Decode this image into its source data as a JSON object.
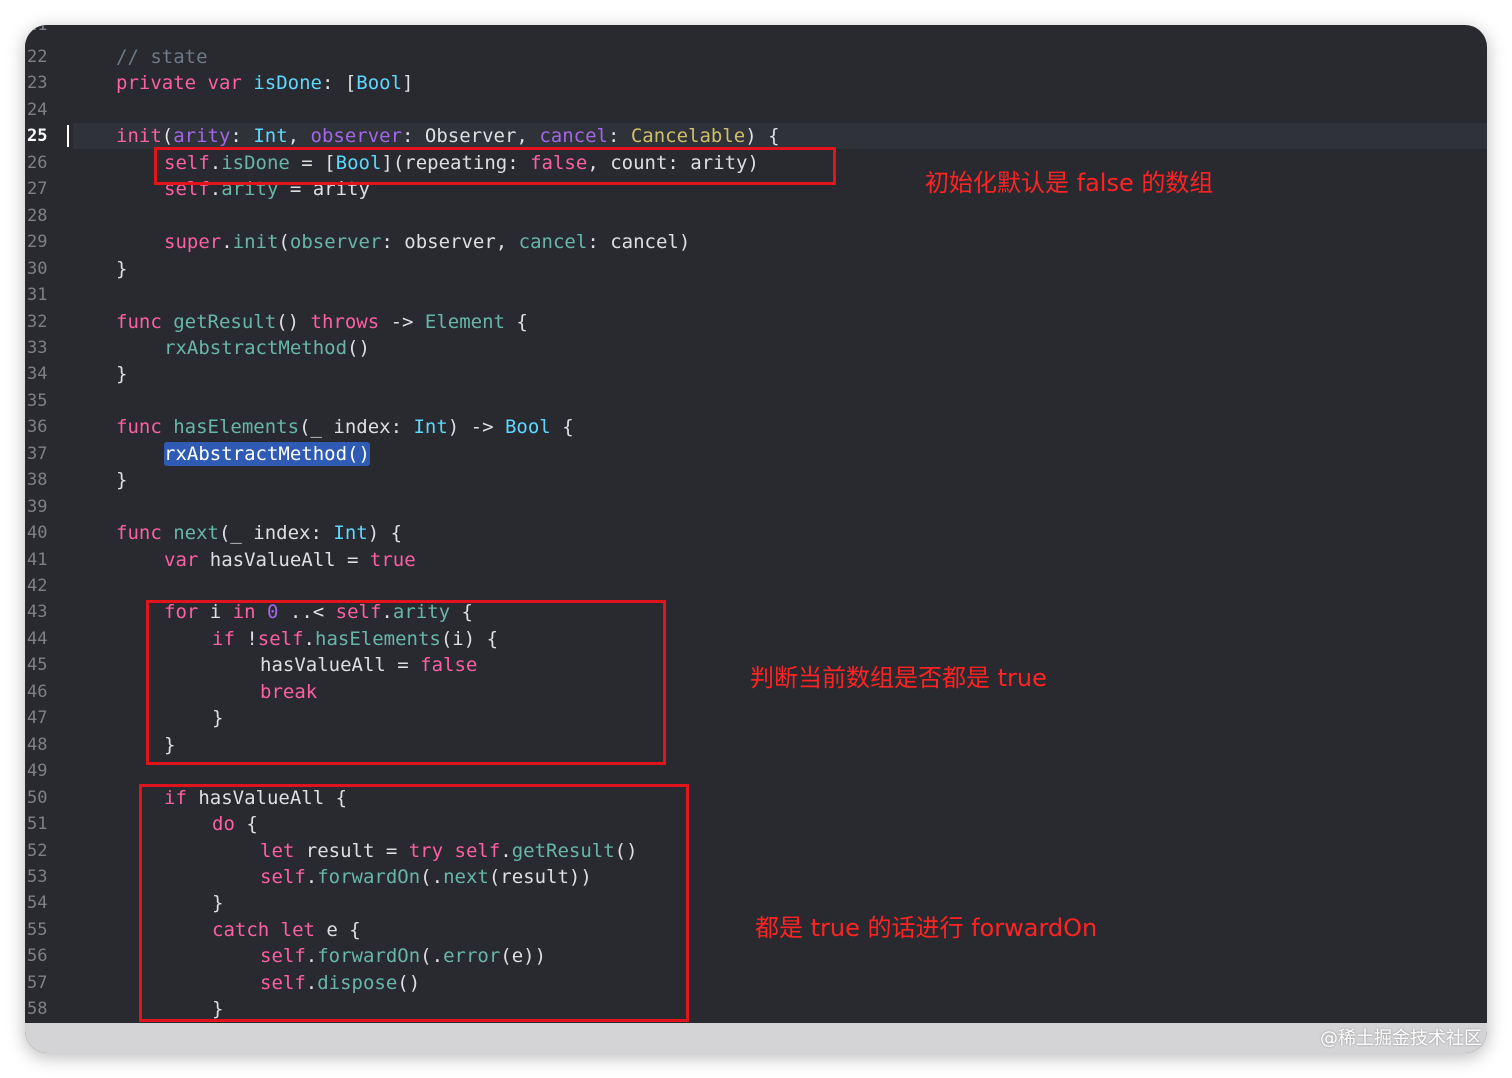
{
  "editor": {
    "partial_line_number": "21",
    "current_line": "25",
    "line_numbers": [
      "22",
      "23",
      "24",
      "25",
      "26",
      "27",
      "28",
      "29",
      "30",
      "31",
      "32",
      "33",
      "34",
      "35",
      "36",
      "37",
      "38",
      "39",
      "40",
      "41",
      "42",
      "43",
      "44",
      "45",
      "46",
      "47",
      "48",
      "49",
      "50",
      "51",
      "52",
      "53",
      "54",
      "55",
      "56",
      "57",
      "58"
    ],
    "code": [
      {
        "indent": 1,
        "tokens": [
          {
            "t": "// state",
            "c": "cm"
          }
        ]
      },
      {
        "indent": 1,
        "tokens": [
          {
            "t": "private",
            "c": "kw"
          },
          {
            "t": " "
          },
          {
            "t": "var",
            "c": "kw"
          },
          {
            "t": " "
          },
          {
            "t": "isDone",
            "c": "ty"
          },
          {
            "t": ": ["
          },
          {
            "t": "Bool",
            "c": "ty"
          },
          {
            "t": "]"
          }
        ]
      },
      {
        "indent": 0,
        "tokens": []
      },
      {
        "indent": 1,
        "tokens": [
          {
            "t": "init",
            "c": "kw"
          },
          {
            "t": "("
          },
          {
            "t": "arity",
            "c": "pr"
          },
          {
            "t": ": "
          },
          {
            "t": "Int",
            "c": "ty"
          },
          {
            "t": ", "
          },
          {
            "t": "observer",
            "c": "pr"
          },
          {
            "t": ": Observer, "
          },
          {
            "t": "cancel",
            "c": "pr"
          },
          {
            "t": ": "
          },
          {
            "t": "Cancelable",
            "c": "num"
          },
          {
            "t": ") {"
          }
        ]
      },
      {
        "indent": 2,
        "tokens": [
          {
            "t": "self",
            "c": "kw"
          },
          {
            "t": "."
          },
          {
            "t": "isDone",
            "c": "fn"
          },
          {
            "t": " = ["
          },
          {
            "t": "Bool",
            "c": "ty"
          },
          {
            "t": "](repeating: "
          },
          {
            "t": "false",
            "c": "kw"
          },
          {
            "t": ", count: arity)"
          }
        ]
      },
      {
        "indent": 2,
        "tokens": [
          {
            "t": "self",
            "c": "kw"
          },
          {
            "t": "."
          },
          {
            "t": "arity",
            "c": "fn"
          },
          {
            "t": " = arity"
          }
        ]
      },
      {
        "indent": 0,
        "tokens": []
      },
      {
        "indent": 2,
        "tokens": [
          {
            "t": "super",
            "c": "kw"
          },
          {
            "t": "."
          },
          {
            "t": "init",
            "c": "fn"
          },
          {
            "t": "("
          },
          {
            "t": "observer",
            "c": "fn"
          },
          {
            "t": ": observer, "
          },
          {
            "t": "cancel",
            "c": "fn"
          },
          {
            "t": ": cancel)"
          }
        ]
      },
      {
        "indent": 1,
        "tokens": [
          {
            "t": "}"
          }
        ]
      },
      {
        "indent": 0,
        "tokens": []
      },
      {
        "indent": 1,
        "tokens": [
          {
            "t": "func",
            "c": "kw"
          },
          {
            "t": " "
          },
          {
            "t": "getResult",
            "c": "fn"
          },
          {
            "t": "() "
          },
          {
            "t": "throws",
            "c": "kw"
          },
          {
            "t": " -> "
          },
          {
            "t": "Element",
            "c": "fn"
          },
          {
            "t": " {"
          }
        ]
      },
      {
        "indent": 2,
        "tokens": [
          {
            "t": "rxAbstractMethod",
            "c": "fn"
          },
          {
            "t": "()"
          }
        ]
      },
      {
        "indent": 1,
        "tokens": [
          {
            "t": "}"
          }
        ]
      },
      {
        "indent": 0,
        "tokens": []
      },
      {
        "indent": 1,
        "tokens": [
          {
            "t": "func",
            "c": "kw"
          },
          {
            "t": " "
          },
          {
            "t": "hasElements",
            "c": "fn"
          },
          {
            "t": "(_ index: "
          },
          {
            "t": "Int",
            "c": "ty"
          },
          {
            "t": ") -> "
          },
          {
            "t": "Bool",
            "c": "ty"
          },
          {
            "t": " {"
          }
        ]
      },
      {
        "indent": 2,
        "tokens": [
          {
            "t": "rxAbstractMethod()",
            "c": "sel"
          }
        ]
      },
      {
        "indent": 1,
        "tokens": [
          {
            "t": "}"
          }
        ]
      },
      {
        "indent": 0,
        "tokens": []
      },
      {
        "indent": 1,
        "tokens": [
          {
            "t": "func",
            "c": "kw"
          },
          {
            "t": " "
          },
          {
            "t": "next",
            "c": "fn"
          },
          {
            "t": "(_ index: "
          },
          {
            "t": "Int",
            "c": "ty"
          },
          {
            "t": ") {"
          }
        ]
      },
      {
        "indent": 2,
        "tokens": [
          {
            "t": "var",
            "c": "kw"
          },
          {
            "t": " hasValueAll = "
          },
          {
            "t": "true",
            "c": "kw"
          }
        ]
      },
      {
        "indent": 0,
        "tokens": []
      },
      {
        "indent": 2,
        "tokens": [
          {
            "t": "for",
            "c": "kw"
          },
          {
            "t": " i "
          },
          {
            "t": "in",
            "c": "kw"
          },
          {
            "t": " "
          },
          {
            "t": "0",
            "c": "pr"
          },
          {
            "t": " ..< "
          },
          {
            "t": "self",
            "c": "kw"
          },
          {
            "t": "."
          },
          {
            "t": "arity",
            "c": "fn"
          },
          {
            "t": " {"
          }
        ]
      },
      {
        "indent": 3,
        "tokens": [
          {
            "t": "if",
            "c": "kw"
          },
          {
            "t": " !"
          },
          {
            "t": "self",
            "c": "kw"
          },
          {
            "t": "."
          },
          {
            "t": "hasElements",
            "c": "fn"
          },
          {
            "t": "(i) {"
          }
        ]
      },
      {
        "indent": 4,
        "tokens": [
          {
            "t": "hasValueAll = "
          },
          {
            "t": "false",
            "c": "kw"
          }
        ]
      },
      {
        "indent": 4,
        "tokens": [
          {
            "t": "break",
            "c": "kw"
          }
        ]
      },
      {
        "indent": 3,
        "tokens": [
          {
            "t": "}"
          }
        ]
      },
      {
        "indent": 2,
        "tokens": [
          {
            "t": "}"
          }
        ]
      },
      {
        "indent": 0,
        "tokens": []
      },
      {
        "indent": 2,
        "tokens": [
          {
            "t": "if",
            "c": "kw"
          },
          {
            "t": " hasValueAll {"
          }
        ]
      },
      {
        "indent": 3,
        "tokens": [
          {
            "t": "do",
            "c": "kw"
          },
          {
            "t": " {"
          }
        ]
      },
      {
        "indent": 4,
        "tokens": [
          {
            "t": "let",
            "c": "kw"
          },
          {
            "t": " result = "
          },
          {
            "t": "try",
            "c": "kw"
          },
          {
            "t": " "
          },
          {
            "t": "self",
            "c": "kw"
          },
          {
            "t": "."
          },
          {
            "t": "getResult",
            "c": "fn"
          },
          {
            "t": "()"
          }
        ]
      },
      {
        "indent": 4,
        "tokens": [
          {
            "t": "self",
            "c": "kw"
          },
          {
            "t": "."
          },
          {
            "t": "forwardOn",
            "c": "fn"
          },
          {
            "t": "(."
          },
          {
            "t": "next",
            "c": "fn"
          },
          {
            "t": "(result))"
          }
        ]
      },
      {
        "indent": 3,
        "tokens": [
          {
            "t": "}"
          }
        ]
      },
      {
        "indent": 3,
        "tokens": [
          {
            "t": "catch",
            "c": "kw"
          },
          {
            "t": " "
          },
          {
            "t": "let",
            "c": "kw"
          },
          {
            "t": " e {"
          }
        ]
      },
      {
        "indent": 4,
        "tokens": [
          {
            "t": "self",
            "c": "kw"
          },
          {
            "t": "."
          },
          {
            "t": "forwardOn",
            "c": "fn"
          },
          {
            "t": "(."
          },
          {
            "t": "error",
            "c": "fn"
          },
          {
            "t": "(e))"
          }
        ]
      },
      {
        "indent": 4,
        "tokens": [
          {
            "t": "self",
            "c": "kw"
          },
          {
            "t": "."
          },
          {
            "t": "dispose",
            "c": "fn"
          },
          {
            "t": "()"
          }
        ]
      },
      {
        "indent": 3,
        "tokens": [
          {
            "t": "}"
          }
        ]
      }
    ]
  },
  "annotations": {
    "first": "初始化默认是 false 的数组",
    "second": "判断当前数组是否都是 true",
    "third": "都是 true 的话进行 forwardOn"
  },
  "watermark": "@稀土掘金技术社区",
  "colors": {
    "background": "#292a30",
    "keyword": "#fc5fa3",
    "type": "#5dd8ff",
    "function": "#67b7a4",
    "parameter": "#a167e6",
    "annotation_red": "#e0141a"
  }
}
